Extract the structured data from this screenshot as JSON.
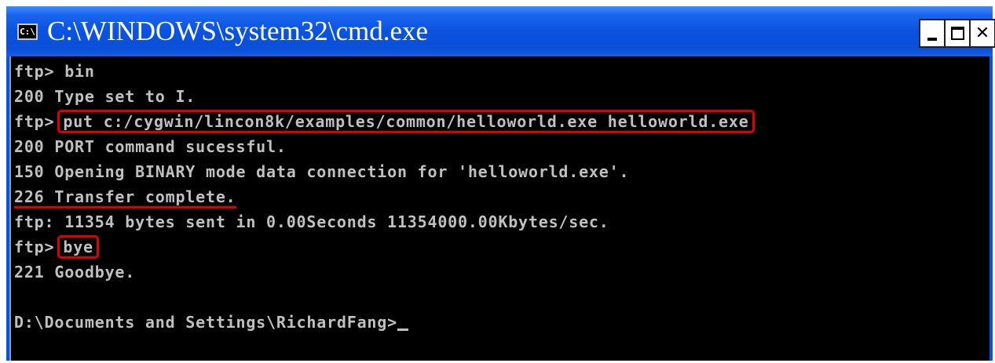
{
  "window": {
    "title": "C:\\WINDOWS\\system32\\cmd.exe",
    "icon_label": "C:\\",
    "buttons": [
      "minimize",
      "maximize",
      "close"
    ]
  },
  "console": {
    "lines": [
      {
        "prompt": "ftp>",
        "text": " bin"
      },
      {
        "text": "200 Type set to I."
      },
      {
        "prompt": "ftp>",
        "text": "put c:/cygwin/lincon8k/examples/common/helloworld.exe helloworld.exe",
        "highlight": "box"
      },
      {
        "text": "200 PORT command sucessful."
      },
      {
        "text": "150 Opening BINARY mode data connection for 'helloworld.exe'."
      },
      {
        "text": "226 Transfer complete.",
        "highlight": "underline"
      },
      {
        "text": "ftp: 11354 bytes sent in 0.00Seconds 11354000.00Kbytes/sec."
      },
      {
        "prompt": "ftp>",
        "text": "bye",
        "highlight": "box"
      },
      {
        "text": "221 Goodbye."
      },
      {
        "text": ""
      },
      {
        "text": "D:\\Documents and Settings\\RichardFang>",
        "cursor": true
      }
    ]
  },
  "colors": {
    "titlebar": "#0a53e0",
    "console_bg": "#000000",
    "console_text": "#c0c0c0",
    "highlight": "#e00000"
  }
}
